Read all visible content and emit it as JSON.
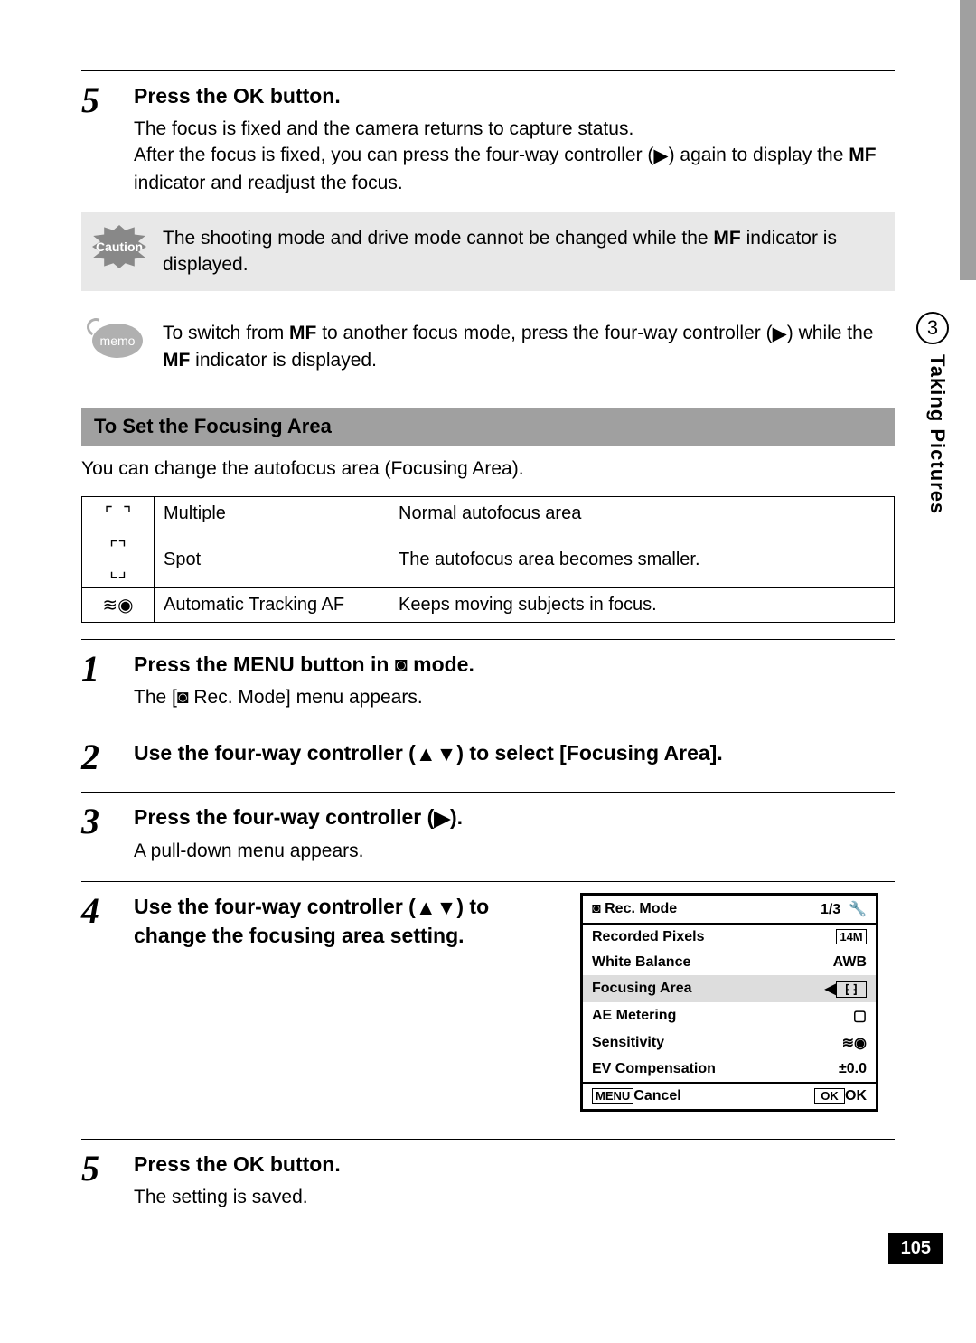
{
  "sidebar": {
    "chapter_number": "3",
    "chapter_title": "Taking Pictures"
  },
  "page_number": "105",
  "step5a": {
    "num": "5",
    "head_before": "Press the ",
    "head_ok": "OK",
    "head_after": " button.",
    "body_l1": "The focus is fixed and the camera returns to capture status.",
    "body_l2_a": "After the focus is fixed, you can press the four-way controller (",
    "body_l2_b": ") again to display the ",
    "body_l2_mf": "MF",
    "body_l2_c": " indicator and readjust the focus."
  },
  "caution": {
    "label": "Caution",
    "text_a": "The shooting mode and drive mode cannot be changed while the ",
    "text_mf": "MF",
    "text_b": " indicator is displayed."
  },
  "memo": {
    "label": "memo",
    "text_a": "To switch from ",
    "text_mf1": "MF",
    "text_b": " to another focus mode, press the four-way controller (",
    "text_c": ") while the ",
    "text_mf2": "MF",
    "text_d": " indicator is displayed."
  },
  "section": {
    "title": "To Set the Focusing Area",
    "intro": "You can change the autofocus area (Focusing Area)."
  },
  "af_table": [
    {
      "icon": "multiple",
      "name": "Multiple",
      "desc": "Normal autofocus area"
    },
    {
      "icon": "spot",
      "name": "Spot",
      "desc": "The autofocus area becomes smaller."
    },
    {
      "icon": "tracking",
      "name": "Automatic Tracking AF",
      "desc": "Keeps moving subjects in focus."
    }
  ],
  "step1": {
    "num": "1",
    "head_a": "Press the ",
    "head_menu": "MENU",
    "head_b": " button in ",
    "head_c": " mode.",
    "body_a": "The [",
    "body_b": " Rec. Mode] menu appears."
  },
  "step2": {
    "num": "2",
    "head_a": "Use the four-way controller (",
    "head_b": ") to select [Focusing Area]."
  },
  "step3": {
    "num": "3",
    "head_a": "Press the four-way controller (",
    "head_b": ").",
    "body": "A pull-down menu appears."
  },
  "step4": {
    "num": "4",
    "head_a": "Use the four-way controller (",
    "head_b": ") to change the focusing area setting."
  },
  "step5b": {
    "num": "5",
    "head_before": "Press the ",
    "head_ok": "OK",
    "head_after": " button.",
    "body": "The setting is saved."
  },
  "lcd": {
    "title": "Rec. Mode",
    "page": "1/3",
    "rows": [
      {
        "label": "Recorded Pixels",
        "value": "14M",
        "box": true
      },
      {
        "label": "White Balance",
        "value": "AWB"
      },
      {
        "label": "Focusing Area",
        "value": "⁅ ⁆",
        "selected": true,
        "dropdown": true
      },
      {
        "label": "AE Metering",
        "value": "▢"
      },
      {
        "label": "Sensitivity",
        "value": "≋◉"
      },
      {
        "label": "EV Compensation",
        "value": "±0.0"
      }
    ],
    "foot_menu_box": "MENU",
    "foot_cancel": "Cancel",
    "foot_ok_box": "OK",
    "foot_ok": "OK"
  }
}
